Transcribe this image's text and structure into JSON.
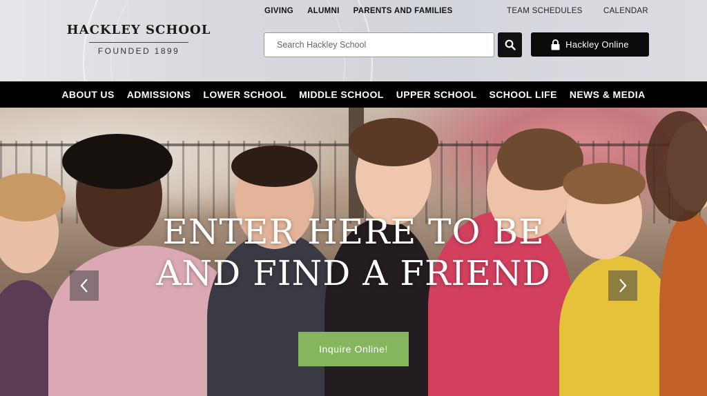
{
  "logo": {
    "name": "HACKLEY SCHOOL",
    "founded": "FOUNDED 1899"
  },
  "utility_nav": {
    "left": [
      "GIVING",
      "ALUMNI",
      "PARENTS AND FAMILIES"
    ],
    "right": [
      "TEAM SCHEDULES",
      "CALENDAR"
    ]
  },
  "search": {
    "placeholder": "Search Hackley School",
    "icon": "search-icon"
  },
  "online_button": {
    "label": "Hackley Online",
    "icon": "lock-icon"
  },
  "main_nav": [
    "ABOUT US",
    "ADMISSIONS",
    "LOWER SCHOOL",
    "MIDDLE SCHOOL",
    "UPPER SCHOOL",
    "SCHOOL LIFE",
    "NEWS & MEDIA"
  ],
  "hero": {
    "title_line1": "ENTER HERE TO BE",
    "title_line2": "AND FIND A FRIEND",
    "cta": "Inquire Online!",
    "prev_icon": "chevron-left-icon",
    "next_icon": "chevron-right-icon"
  },
  "colors": {
    "cta": "#85b65e",
    "nav_bg": "#000000",
    "button_bg": "#0b0b0b"
  }
}
